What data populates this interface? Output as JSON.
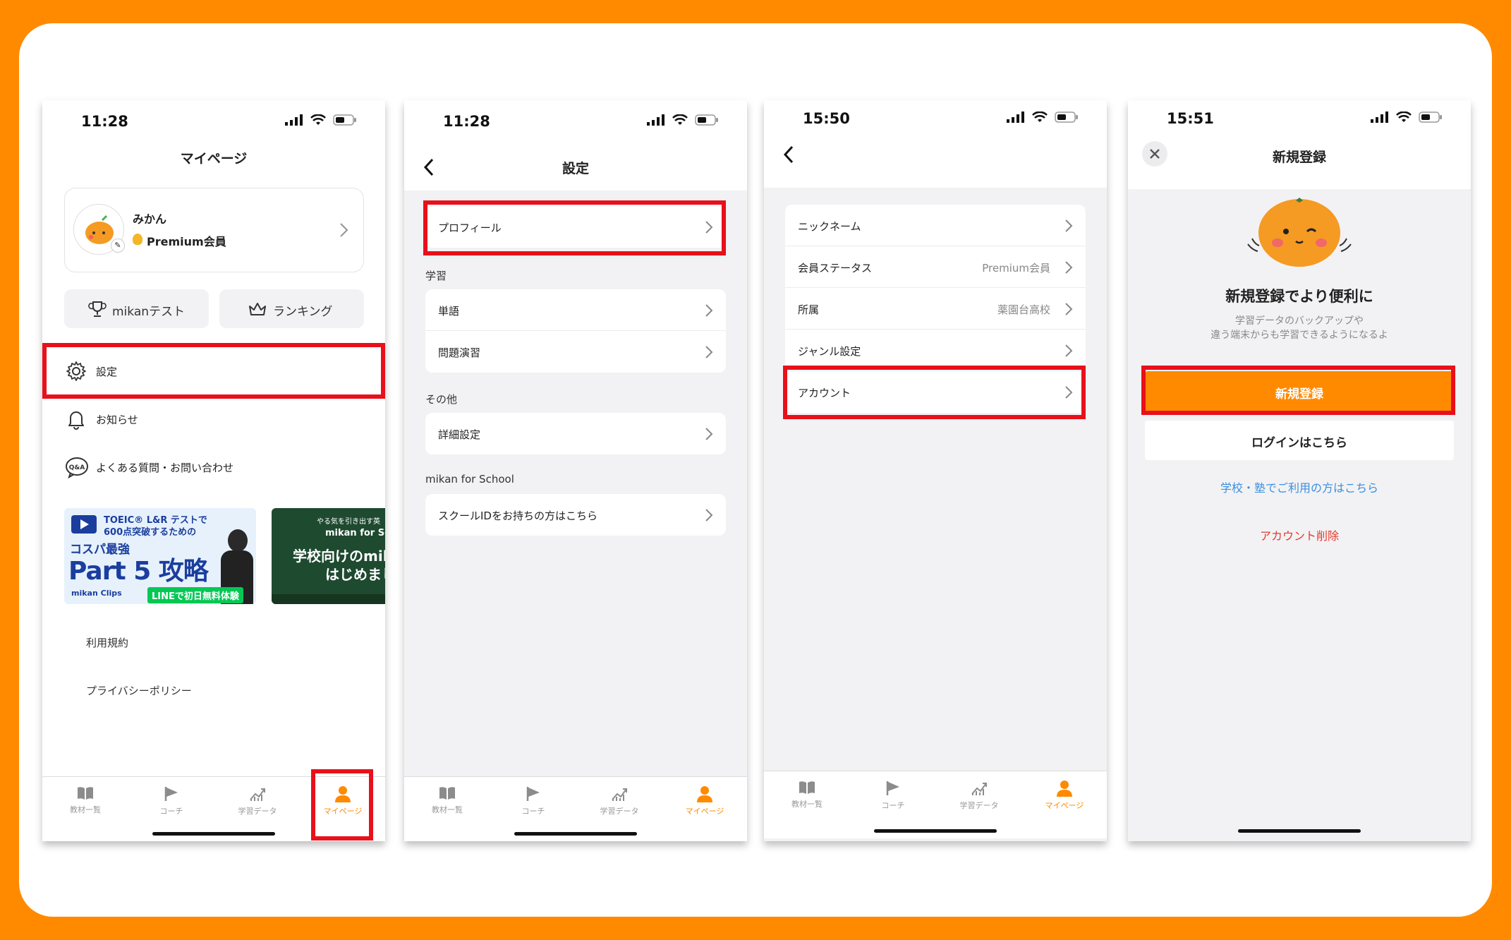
{
  "status": {
    "p1_time": "11:28",
    "p2_time": "11:28",
    "p3_time": "15:50",
    "p4_time": "15:51"
  },
  "tabs": [
    "教材一覧",
    "コーチ",
    "学習データ",
    "マイページ"
  ],
  "colors": {
    "accent": "#FF8A00",
    "highlight": "#E8101A",
    "link": "#3B8FE0",
    "danger": "#E8392D"
  },
  "mypage": {
    "title": "マイページ",
    "user_name": "みかん",
    "membership": "Premium会員",
    "test_button": "mikanテスト",
    "ranking_button": "ランキング",
    "menu": [
      "設定",
      "お知らせ",
      "よくある質問・お問い合わせ"
    ],
    "banner1": {
      "line1": "TOEIC® L&R テストで",
      "line2": "600点突破するための",
      "line3": "コスパ最強",
      "big": "Part 5 攻略",
      "brand": "mikan Clips",
      "cta": "LINEで初日無料体験"
    },
    "banner2": {
      "line1": "やる気を引き出す英",
      "line2": "mikan for Sc",
      "line3": "学校向けのmik",
      "line4": "はじめまし"
    },
    "links": [
      "利用規約",
      "プライバシーポリシー"
    ]
  },
  "settings": {
    "title": "設定",
    "profile": "プロフィール",
    "section_study": "学習",
    "study_items": [
      "単語",
      "問題演習"
    ],
    "section_other": "その他",
    "other_items": [
      "詳細設定"
    ],
    "section_school": "mikan for School",
    "school_items": [
      "スクールIDをお持ちの方はこちら"
    ]
  },
  "profile": {
    "rows": [
      {
        "label": "ニックネーム",
        "value": ""
      },
      {
        "label": "会員ステータス",
        "value": "Premium会員"
      },
      {
        "label": "所属",
        "value": "薬園台高校"
      },
      {
        "label": "ジャンル設定",
        "value": ""
      },
      {
        "label": "アカウント",
        "value": ""
      }
    ]
  },
  "register": {
    "title": "新規登録",
    "headline": "新規登録でより便利に",
    "sub1": "学習データのバックアップや",
    "sub2": "違う端末からも学習できるようになるよ",
    "register_button": "新規登録",
    "login_button": "ログインはこちら",
    "school_link": "学校・塾でご利用の方はこちら",
    "delete_link": "アカウント削除"
  }
}
